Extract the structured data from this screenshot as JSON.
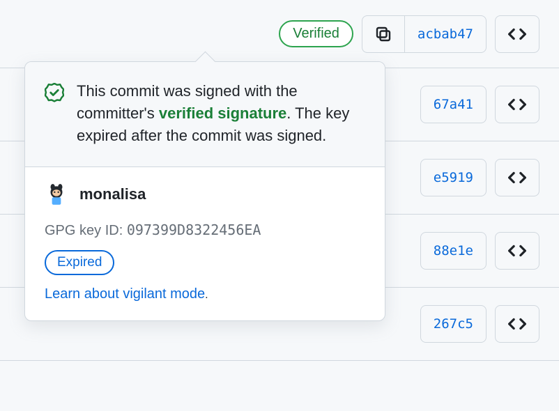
{
  "verified_badge_label": "Verified",
  "commits": [
    {
      "hash": "acbab47"
    },
    {
      "hash": "67a41"
    },
    {
      "hash": "e5919"
    },
    {
      "hash": "88e1e"
    },
    {
      "hash": "267c5"
    }
  ],
  "popover": {
    "message_prefix": "This commit was signed with the committer's ",
    "signature_link": "verified signature",
    "message_suffix": ". The key expired after the commit was signed.",
    "username": "monalisa",
    "key_label": "GPG key ID: ",
    "key_id": "097399D8322456EA",
    "expired_label": "Expired",
    "vigilant_link": "Learn about vigilant mode",
    "vigilant_suffix": "."
  }
}
